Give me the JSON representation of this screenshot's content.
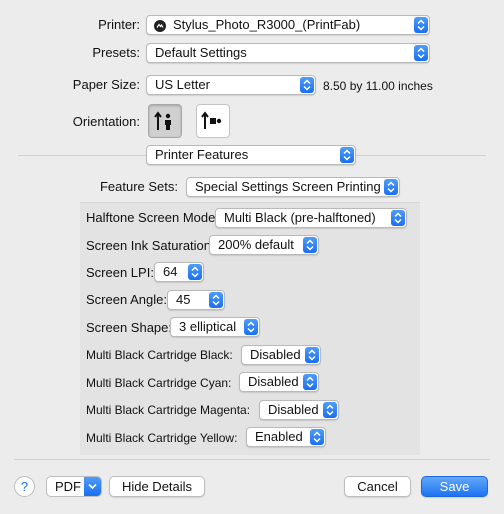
{
  "printer": {
    "label": "Printer:",
    "value": "Stylus_Photo_R3000_(PrintFab)",
    "icon": "printer-badge-icon"
  },
  "presets": {
    "label": "Presets:",
    "value": "Default Settings"
  },
  "paper_size": {
    "label": "Paper Size:",
    "value": "US Letter",
    "dimensions": "8.50 by 11.00 inches"
  },
  "orientation": {
    "label": "Orientation:",
    "options": [
      "portrait",
      "landscape"
    ],
    "selected": "portrait"
  },
  "section": {
    "value": "Printer Features"
  },
  "feature_sets": {
    "label": "Feature Sets:",
    "value": "Special Settings Screen Printing"
  },
  "features": {
    "halftone_mode": {
      "label": "Halftone Screen Mode:",
      "value": "Multi Black (pre-halftoned)"
    },
    "ink_saturation": {
      "label": "Screen Ink Saturation:",
      "value": "200% default"
    },
    "lpi": {
      "label": "Screen LPI:",
      "value": "64"
    },
    "angle": {
      "label": "Screen Angle:",
      "value": "45"
    },
    "shape": {
      "label": "Screen Shape:",
      "value": "3 elliptical"
    },
    "cart_black": {
      "label": "Multi Black Cartridge Black:",
      "value": "Disabled"
    },
    "cart_cyan": {
      "label": "Multi Black Cartridge Cyan:",
      "value": "Disabled"
    },
    "cart_magenta": {
      "label": "Multi Black Cartridge Magenta:",
      "value": "Disabled"
    },
    "cart_yellow": {
      "label": "Multi Black Cartridge Yellow:",
      "value": "Enabled"
    }
  },
  "footer": {
    "help": "?",
    "pdf": "PDF",
    "hide_details": "Hide Details",
    "cancel": "Cancel",
    "save": "Save"
  },
  "colors": {
    "accent": "#1a6ff2",
    "background": "#ececec",
    "panel": "#e3e3e3"
  }
}
